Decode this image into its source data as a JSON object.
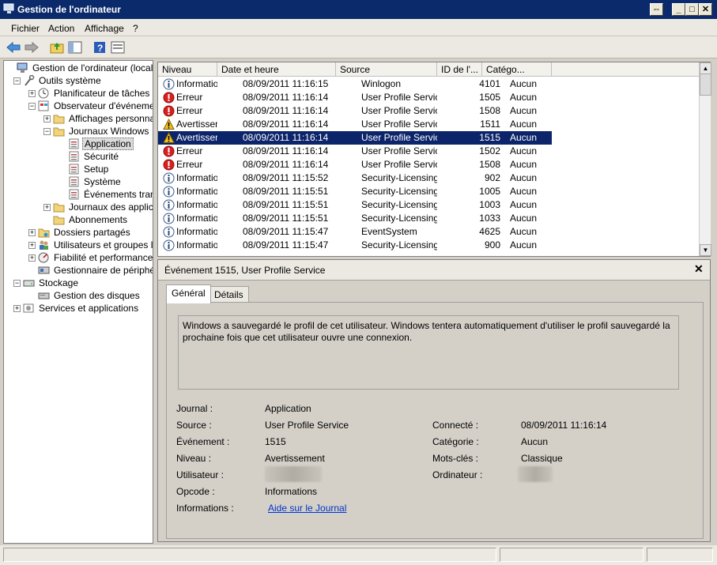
{
  "window": {
    "title": "Gestion de l'ordinateur"
  },
  "menu": [
    "Fichier",
    "Action",
    "Affichage",
    "?"
  ],
  "tree": [
    {
      "label": "Gestion de l'ordinateur (local)",
      "level": 0,
      "exp": "",
      "icon": "computer-icon"
    },
    {
      "label": "Outils système",
      "level": 1,
      "exp": "−",
      "icon": "tools-icon"
    },
    {
      "label": "Planificateur de tâches",
      "level": 2,
      "exp": "+",
      "icon": "clock-icon"
    },
    {
      "label": "Observateur d'événement",
      "level": 2,
      "exp": "−",
      "icon": "event-viewer-icon"
    },
    {
      "label": "Affichages personnalisés",
      "level": 3,
      "exp": "+",
      "icon": "folder-icon"
    },
    {
      "label": "Journaux Windows",
      "level": 3,
      "exp": "−",
      "icon": "folder-icon"
    },
    {
      "label": "Application",
      "level": 4,
      "exp": "",
      "icon": "log-icon",
      "selected": true
    },
    {
      "label": "Sécurité",
      "level": 4,
      "exp": "",
      "icon": "log-icon"
    },
    {
      "label": "Setup",
      "level": 4,
      "exp": "",
      "icon": "log-icon"
    },
    {
      "label": "Système",
      "level": 4,
      "exp": "",
      "icon": "log-icon"
    },
    {
      "label": "Événements transférés",
      "level": 4,
      "exp": "",
      "icon": "log-icon"
    },
    {
      "label": "Journaux des applications",
      "level": 3,
      "exp": "+",
      "icon": "folder-icon"
    },
    {
      "label": "Abonnements",
      "level": 3,
      "exp": "",
      "icon": "folder-icon"
    },
    {
      "label": "Dossiers partagés",
      "level": 2,
      "exp": "+",
      "icon": "shared-folder-icon"
    },
    {
      "label": "Utilisateurs et groupes locaux",
      "level": 2,
      "exp": "+",
      "icon": "users-icon"
    },
    {
      "label": "Fiabilité et performances",
      "level": 2,
      "exp": "+",
      "icon": "performance-icon"
    },
    {
      "label": "Gestionnaire de périphériques",
      "level": 2,
      "exp": "",
      "icon": "device-manager-icon"
    },
    {
      "label": "Stockage",
      "level": 1,
      "exp": "−",
      "icon": "storage-icon"
    },
    {
      "label": "Gestion des disques",
      "level": 2,
      "exp": "",
      "icon": "disk-icon"
    },
    {
      "label": "Services et applications",
      "level": 1,
      "exp": "+",
      "icon": "services-icon"
    }
  ],
  "columns": [
    "Niveau",
    "Date et heure",
    "Source",
    "ID de l'...",
    "Catégo..."
  ],
  "events": [
    {
      "level": "Information",
      "type": "info",
      "date": "08/09/2011 11:16:15",
      "source": "Winlogon",
      "id": "4101",
      "cat": "Aucun"
    },
    {
      "level": "Erreur",
      "type": "error",
      "date": "08/09/2011 11:16:14",
      "source": "User Profile Service",
      "id": "1505",
      "cat": "Aucun"
    },
    {
      "level": "Erreur",
      "type": "error",
      "date": "08/09/2011 11:16:14",
      "source": "User Profile Service",
      "id": "1508",
      "cat": "Aucun"
    },
    {
      "level": "Avertissement",
      "type": "warn",
      "date": "08/09/2011 11:16:14",
      "source": "User Profile Service",
      "id": "1511",
      "cat": "Aucun"
    },
    {
      "level": "Avertissement",
      "type": "warn",
      "date": "08/09/2011 11:16:14",
      "source": "User Profile Service",
      "id": "1515",
      "cat": "Aucun",
      "selected": true
    },
    {
      "level": "Erreur",
      "type": "error",
      "date": "08/09/2011 11:16:14",
      "source": "User Profile Service",
      "id": "1502",
      "cat": "Aucun"
    },
    {
      "level": "Erreur",
      "type": "error",
      "date": "08/09/2011 11:16:14",
      "source": "User Profile Service",
      "id": "1508",
      "cat": "Aucun"
    },
    {
      "level": "Information",
      "type": "info",
      "date": "08/09/2011 11:15:52",
      "source": "Security-Licensing-SLC",
      "id": "902",
      "cat": "Aucun"
    },
    {
      "level": "Information",
      "type": "info",
      "date": "08/09/2011 11:15:51",
      "source": "Security-Licensing-SLC",
      "id": "1005",
      "cat": "Aucun"
    },
    {
      "level": "Information",
      "type": "info",
      "date": "08/09/2011 11:15:51",
      "source": "Security-Licensing-SLC",
      "id": "1003",
      "cat": "Aucun"
    },
    {
      "level": "Information",
      "type": "info",
      "date": "08/09/2011 11:15:51",
      "source": "Security-Licensing-SLC",
      "id": "1033",
      "cat": "Aucun"
    },
    {
      "level": "Information",
      "type": "info",
      "date": "08/09/2011 11:15:47",
      "source": "EventSystem",
      "id": "4625",
      "cat": "Aucun"
    },
    {
      "level": "Information",
      "type": "info",
      "date": "08/09/2011 11:15:47",
      "source": "Security-Licensing-SLC",
      "id": "900",
      "cat": "Aucun"
    }
  ],
  "detail": {
    "title": "Événement 1515, User Profile Service",
    "tabs": [
      "Général",
      "Détails"
    ],
    "message": "Windows a sauvegardé le profil de cet utilisateur. Windows tentera automatiquement d'utiliser le profil sauvegardé la prochaine fois que cet utilisateur ouvre une connexion.",
    "labels": {
      "journal": "Journal :",
      "source": "Source :",
      "evenement": "Événement :",
      "niveau": "Niveau :",
      "utilisateur": "Utilisateur :",
      "opcode": "Opcode :",
      "informations": "Informations :",
      "connecte": "Connecté :",
      "categorie": "Catégorie :",
      "motscles": "Mots-clés :",
      "ordinateur": "Ordinateur :"
    },
    "values": {
      "journal": "Application",
      "source": "User Profile Service",
      "evenement": "1515",
      "niveau": "Avertissement",
      "opcode": "Informations",
      "informations": "Aide sur le Journal",
      "connecte": "08/09/2011 11:16:14",
      "categorie": "Aucun",
      "motscles": "Classique"
    }
  }
}
